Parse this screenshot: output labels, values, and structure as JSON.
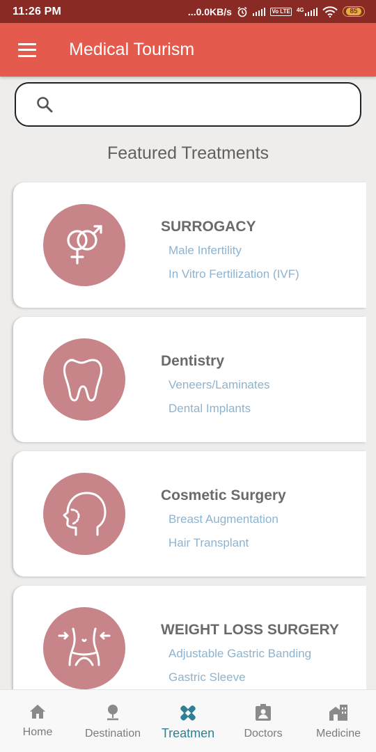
{
  "status_bar": {
    "time": "11:26 PM",
    "network_speed": "...0.0KB/s",
    "volte_label": "Vo LTE",
    "lte_label": "4G",
    "battery_level": "85"
  },
  "app_bar": {
    "title": "Medical Tourism"
  },
  "search": {
    "placeholder": "",
    "value": ""
  },
  "section_title": "Featured Treatments",
  "treatments": [
    {
      "name": "SURROGACY",
      "items": [
        "Male Infertility",
        "In Vitro Fertilization (IVF)"
      ],
      "icon": "gender-icon"
    },
    {
      "name": "Dentistry",
      "items": [
        "Veneers/Laminates",
        "Dental Implants"
      ],
      "icon": "tooth-icon"
    },
    {
      "name": "Cosmetic Surgery",
      "items": [
        "Breast Augmentation",
        "Hair Transplant"
      ],
      "icon": "face-profile-icon"
    },
    {
      "name": "WEIGHT LOSS SURGERY",
      "items": [
        "Adjustable Gastric Banding",
        "Gastric Sleeve"
      ],
      "icon": "waist-icon"
    }
  ],
  "bottom_nav": [
    {
      "label": "Home",
      "icon": "home-icon"
    },
    {
      "label": "Destination",
      "icon": "location-pin-icon"
    },
    {
      "label": "Treatmen",
      "icon": "bandage-icon",
      "active": true
    },
    {
      "label": "Doctors",
      "icon": "doctor-badge-icon"
    },
    {
      "label": "Medicine",
      "icon": "building-icon"
    }
  ],
  "colors": {
    "status_bar": "#8a2a24",
    "app_bar": "#e45a4d",
    "icon_circle": "#c7858a",
    "link_text": "#8db3cf",
    "active_nav": "#2f7f95"
  }
}
